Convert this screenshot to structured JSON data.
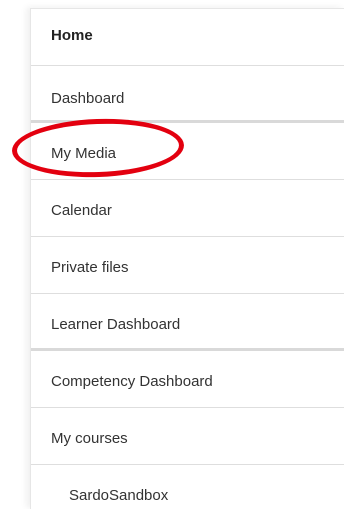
{
  "nav": {
    "items": [
      {
        "label": "Home"
      },
      {
        "label": "Dashboard"
      },
      {
        "label": "My Media"
      },
      {
        "label": "Calendar"
      },
      {
        "label": "Private files"
      },
      {
        "label": "Learner Dashboard"
      },
      {
        "label": "Competency Dashboard"
      },
      {
        "label": "My courses"
      },
      {
        "label": "SardoSandbox"
      }
    ]
  },
  "annotation": {
    "color": "#e3000f",
    "target": "My Media"
  }
}
